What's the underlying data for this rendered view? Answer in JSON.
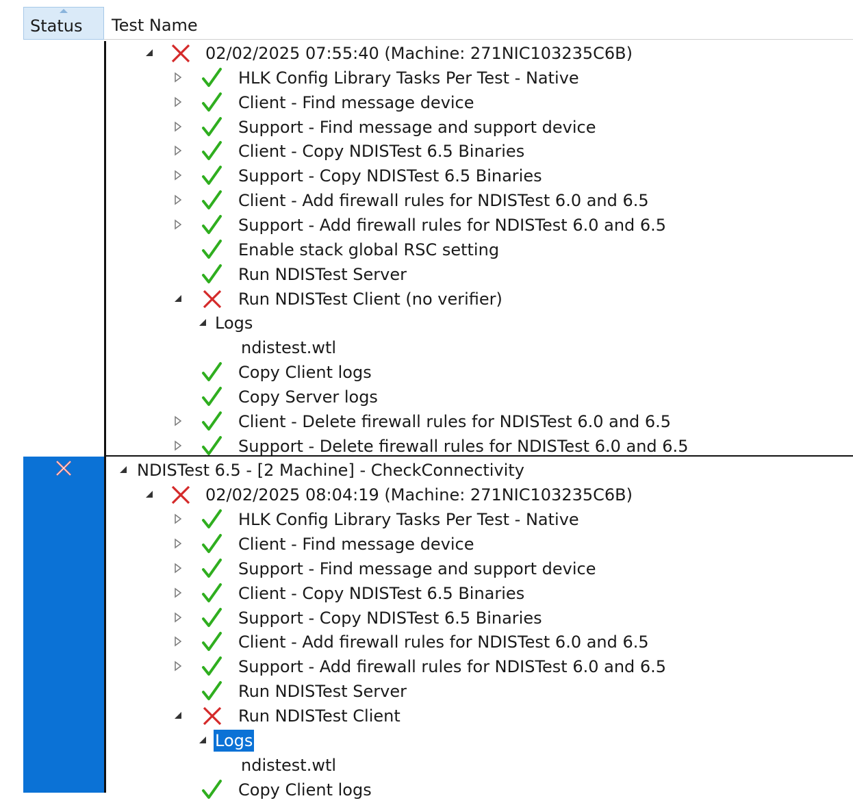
{
  "columns": {
    "status": "Status",
    "test_name": "Test Name"
  },
  "rows": [
    {
      "depth": 1,
      "expander": "expanded",
      "status": "fail",
      "label": "02/02/2025 07:55:40 (Machine: 271NIC103235C6B)"
    },
    {
      "depth": 2,
      "expander": "collapsed",
      "status": "pass",
      "label": "HLK Config Library Tasks Per Test - Native"
    },
    {
      "depth": 2,
      "expander": "collapsed",
      "status": "pass",
      "label": "Client - Find message device"
    },
    {
      "depth": 2,
      "expander": "collapsed",
      "status": "pass",
      "label": "Support - Find message and support device"
    },
    {
      "depth": 2,
      "expander": "collapsed",
      "status": "pass",
      "label": "Client - Copy NDISTest 6.5 Binaries"
    },
    {
      "depth": 2,
      "expander": "collapsed",
      "status": "pass",
      "label": "Support - Copy NDISTest 6.5 Binaries"
    },
    {
      "depth": 2,
      "expander": "collapsed",
      "status": "pass",
      "label": "Client - Add firewall rules for NDISTest 6.0 and 6.5"
    },
    {
      "depth": 2,
      "expander": "collapsed",
      "status": "pass",
      "label": "Support - Add firewall rules for NDISTest 6.0 and 6.5"
    },
    {
      "depth": 2,
      "expander": "none",
      "status": "pass",
      "label": "Enable stack global RSC setting"
    },
    {
      "depth": 2,
      "expander": "none",
      "status": "pass",
      "label": "Run NDISTest Server"
    },
    {
      "depth": 2,
      "expander": "expanded",
      "status": "fail",
      "label": "Run NDISTest Client (no verifier)"
    },
    {
      "depth": 3,
      "expander": "expanded",
      "status": "none",
      "label": "Logs"
    },
    {
      "depth": 4,
      "expander": "none",
      "status": "none",
      "label": "ndistest.wtl"
    },
    {
      "depth": 2,
      "expander": "none",
      "status": "pass",
      "label": "Copy Client logs"
    },
    {
      "depth": 2,
      "expander": "none",
      "status": "pass",
      "label": "Copy Server logs"
    },
    {
      "depth": 2,
      "expander": "collapsed",
      "status": "pass",
      "label": "Client - Delete firewall rules for NDISTest 6.0 and 6.5"
    },
    {
      "depth": 2,
      "expander": "collapsed",
      "status": "pass",
      "label": "Support - Delete firewall rules for NDISTest 6.0 and 6.5"
    },
    {
      "depth": 0,
      "expander": "expanded",
      "status": "none",
      "label": "NDISTest 6.5 - [2 Machine] - CheckConnectivity",
      "group_start": true,
      "group_status": "fail"
    },
    {
      "depth": 1,
      "expander": "expanded",
      "status": "fail",
      "label": "02/02/2025 08:04:19 (Machine: 271NIC103235C6B)"
    },
    {
      "depth": 2,
      "expander": "collapsed",
      "status": "pass",
      "label": "HLK Config Library Tasks Per Test - Native"
    },
    {
      "depth": 2,
      "expander": "collapsed",
      "status": "pass",
      "label": "Client - Find message device"
    },
    {
      "depth": 2,
      "expander": "collapsed",
      "status": "pass",
      "label": "Support - Find message and support device"
    },
    {
      "depth": 2,
      "expander": "collapsed",
      "status": "pass",
      "label": "Client - Copy NDISTest 6.5 Binaries"
    },
    {
      "depth": 2,
      "expander": "collapsed",
      "status": "pass",
      "label": "Support - Copy NDISTest 6.5 Binaries"
    },
    {
      "depth": 2,
      "expander": "collapsed",
      "status": "pass",
      "label": "Client - Add firewall rules for NDISTest 6.0 and 6.5"
    },
    {
      "depth": 2,
      "expander": "collapsed",
      "status": "pass",
      "label": "Support - Add firewall rules for NDISTest 6.0 and 6.5"
    },
    {
      "depth": 2,
      "expander": "none",
      "status": "pass",
      "label": "Run NDISTest Server"
    },
    {
      "depth": 2,
      "expander": "expanded",
      "status": "fail",
      "label": "Run NDISTest Client"
    },
    {
      "depth": 3,
      "expander": "expanded",
      "status": "none",
      "label": "Logs",
      "selected": true
    },
    {
      "depth": 4,
      "expander": "none",
      "status": "none",
      "label": "ndistest.wtl"
    },
    {
      "depth": 2,
      "expander": "none",
      "status": "pass",
      "label": "Copy Client logs"
    }
  ],
  "colors": {
    "pass": "#2fae1f",
    "fail": "#d42a2a",
    "selection": "#0b72d6",
    "header_status_bg": "#daeaf8"
  },
  "icons": {
    "pass": "checkmark-icon",
    "fail": "cross-icon",
    "expanded": "triangle-expanded-icon",
    "collapsed": "triangle-collapsed-icon",
    "sort": "sort-ascending-icon"
  }
}
